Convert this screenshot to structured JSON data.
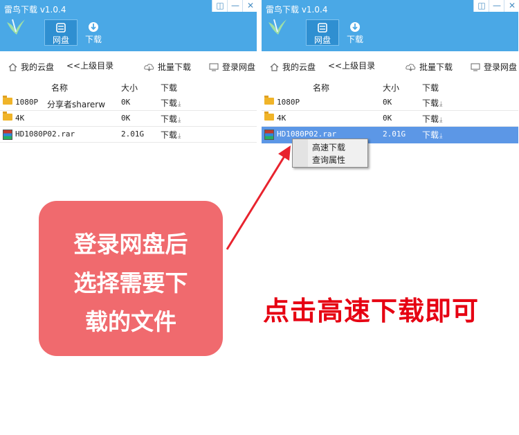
{
  "app": {
    "title": "雷鸟下载 v1.0.4"
  },
  "window_controls": {
    "restore": "◫",
    "minimize": "—",
    "close": "✕"
  },
  "toolbar_top": {
    "cloud_label": "网盘",
    "download_label": "下载"
  },
  "toolbar": {
    "my_cloud": "我的云盘",
    "up_dir": "<<上级目录",
    "batch_download": "批量下载",
    "login": "登录网盘",
    "icons": {
      "home": "home-icon",
      "cloud": "cloud-download-icon",
      "login": "monitor-icon"
    }
  },
  "table": {
    "headers": [
      "名称",
      "大小",
      "下载"
    ],
    "rows": [
      {
        "name": "1080P",
        "size": "0K",
        "download": "下载",
        "type": "folder"
      },
      {
        "name": "4K",
        "size": "0K",
        "download": "下载",
        "type": "folder"
      },
      {
        "name": "HD1080P02.rar",
        "size": "2.01G",
        "download": "下载",
        "type": "rar"
      }
    ]
  },
  "overlay_text": "分享者sharerw",
  "context_menu": {
    "items": [
      "高速下载",
      "查询属性"
    ]
  },
  "callout": {
    "lines": [
      "登录网盘后",
      "选择需要下",
      "载的文件"
    ]
  },
  "instruction": "点击高速下载即可",
  "colors": {
    "titlebar": "#4aa8e6",
    "selection": "#5c97e6",
    "callout": "#f06a6e",
    "accent_red": "#e60012"
  }
}
